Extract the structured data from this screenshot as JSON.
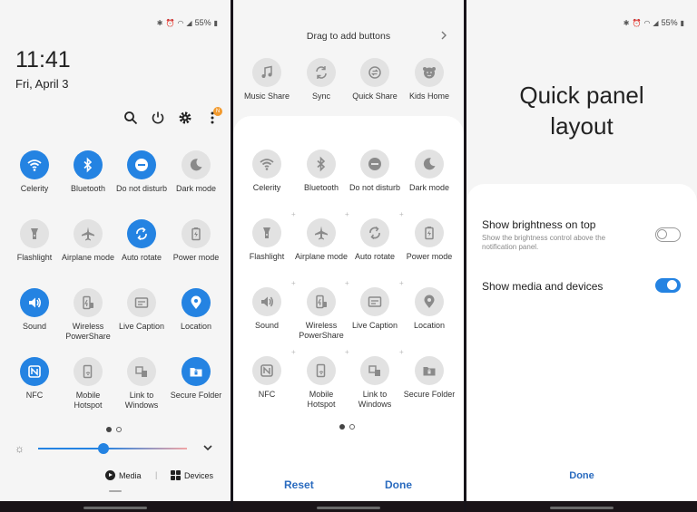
{
  "status": {
    "battery": "55%"
  },
  "screen1": {
    "time": "11:41",
    "date": "Fri, April 3",
    "notif_badge": "N",
    "tiles": [
      {
        "label": "Celerity",
        "icon": "wifi-icon",
        "on": true
      },
      {
        "label": "Bluetooth",
        "icon": "bluetooth-icon",
        "on": true
      },
      {
        "label": "Do not disturb",
        "icon": "dnd-icon",
        "on": true
      },
      {
        "label": "Dark mode",
        "icon": "moon-icon",
        "on": false
      },
      {
        "label": "Flashlight",
        "icon": "flashlight-icon",
        "on": false
      },
      {
        "label": "Airplane mode",
        "icon": "airplane-icon",
        "on": false
      },
      {
        "label": "Auto rotate",
        "icon": "rotate-icon",
        "on": true
      },
      {
        "label": "Power mode",
        "icon": "battery-icon",
        "on": false
      },
      {
        "label": "Sound",
        "icon": "speaker-icon",
        "on": true
      },
      {
        "label": "Wireless PowerShare",
        "icon": "powershare-icon",
        "on": false
      },
      {
        "label": "Live Caption",
        "icon": "caption-icon",
        "on": false
      },
      {
        "label": "Location",
        "icon": "location-icon",
        "on": true
      },
      {
        "label": "NFC",
        "icon": "nfc-icon",
        "on": true
      },
      {
        "label": "Mobile Hotspot",
        "icon": "hotspot-icon",
        "on": false
      },
      {
        "label": "Link to Windows",
        "icon": "link-windows-icon",
        "on": false
      },
      {
        "label": "Secure Folder",
        "icon": "folder-icon",
        "on": true
      }
    ],
    "brightness": 0.44,
    "media_label": "Media",
    "devices_label": "Devices"
  },
  "screen2": {
    "drag_title": "Drag to add buttons",
    "extra_tiles": [
      {
        "label": "Music Share",
        "icon": "music-icon"
      },
      {
        "label": "Sync",
        "icon": "sync-icon"
      },
      {
        "label": "Quick Share",
        "icon": "quickshare-icon"
      },
      {
        "label": "Kids Home",
        "icon": "kids-icon"
      }
    ],
    "reset_label": "Reset",
    "done_label": "Done"
  },
  "screen3": {
    "title_line1": "Quick panel",
    "title_line2": "layout",
    "brightness_title": "Show brightness on top",
    "brightness_sub": "Show the brightness control above the notification panel.",
    "brightness_on": false,
    "media_title": "Show media and devices",
    "media_on": true,
    "done_label": "Done"
  }
}
